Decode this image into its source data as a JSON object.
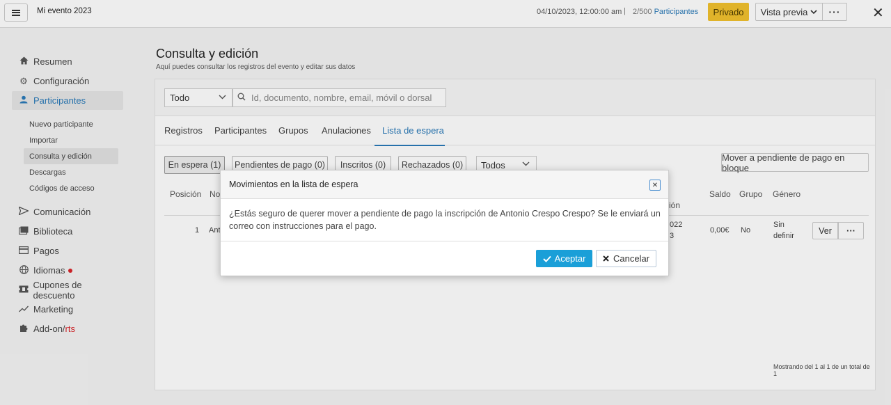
{
  "topbar": {
    "event_name": "Mi evento 2023",
    "datetime": "04/10/2023, 12:00:00 am",
    "separator": "|",
    "participants_count": "2/500",
    "participants_label": "Participantes",
    "privado_label": "Privado",
    "preview_label": "Vista previa",
    "more_label": "···",
    "close_label": "✕"
  },
  "sidebar": {
    "items": [
      {
        "label": "Resumen",
        "icon": "home-icon"
      },
      {
        "label": "Configuración",
        "icon": "gear-icon"
      },
      {
        "label": "Participantes",
        "icon": "user-icon"
      },
      {
        "label": "Comunicación",
        "icon": "send-icon"
      },
      {
        "label": "Biblioteca",
        "icon": "library-icon"
      },
      {
        "label": "Pagos",
        "icon": "card-icon"
      },
      {
        "label": "Idiomas",
        "icon": "globe-icon"
      },
      {
        "label": "Cupones de descuento",
        "icon": "ticket-icon"
      },
      {
        "label": "Marketing",
        "icon": "trend-icon"
      },
      {
        "label": "Add-on/",
        "label_suffix": "rts",
        "icon": "puzzle-icon"
      }
    ],
    "sub_items": [
      {
        "label": "Nuevo participante"
      },
      {
        "label": "Importar"
      },
      {
        "label": "Consulta y edición"
      },
      {
        "label": "Descargas"
      },
      {
        "label": "Códigos de acceso"
      }
    ]
  },
  "main": {
    "title": "Consulta y edición",
    "subtitle": "Aquí puedes consultar los registros del evento y editar sus datos",
    "type_select": "Todo",
    "search_placeholder": "Id, documento, nombre, email, móvil o dorsal",
    "tabs": [
      {
        "label": "Registros"
      },
      {
        "label": "Participantes"
      },
      {
        "label": "Grupos"
      },
      {
        "label": "Anulaciones"
      },
      {
        "label": "Lista de espera"
      }
    ],
    "active_tab": "Lista de espera",
    "status_pills": [
      {
        "label": "En espera (1)"
      },
      {
        "label": "Pendientes de pago (0)"
      },
      {
        "label": "Inscritos (0)"
      },
      {
        "label": "Rechazados (0)"
      }
    ],
    "filter_select": "Todos",
    "bulk_button": "Mover a pendiente de pago en bloque",
    "columns": {
      "position": "Posición",
      "name_partial": "No",
      "date_partial": "ión",
      "balance": "Saldo",
      "group": "Grupo",
      "gender": "Género"
    },
    "row": {
      "position": "1",
      "name_partial": "Ant",
      "date_partial_1": "022",
      "date_partial_2": "3",
      "balance": "0,00€",
      "group": "No",
      "gender_1": "Sin",
      "gender_2": "definir",
      "view_button": "Ver",
      "more_button": "···"
    },
    "footer": "Mostrando del 1 al 1 de un total de 1"
  },
  "modal": {
    "title": "Movimientos en la lista de espera",
    "close_label": "✕",
    "body": "¿Estás seguro de querer mover a pendiente de pago la inscripción de Antonio Crespo Crespo? Se le enviará un correo con instrucciones para el pago.",
    "accept_label": "Aceptar",
    "cancel_label": "Cancelar"
  },
  "colors": {
    "accent": "#2a7ab8",
    "privado": "#f2c12e",
    "accept": "#1a9fd8",
    "notification_dot": "#d9252a"
  }
}
